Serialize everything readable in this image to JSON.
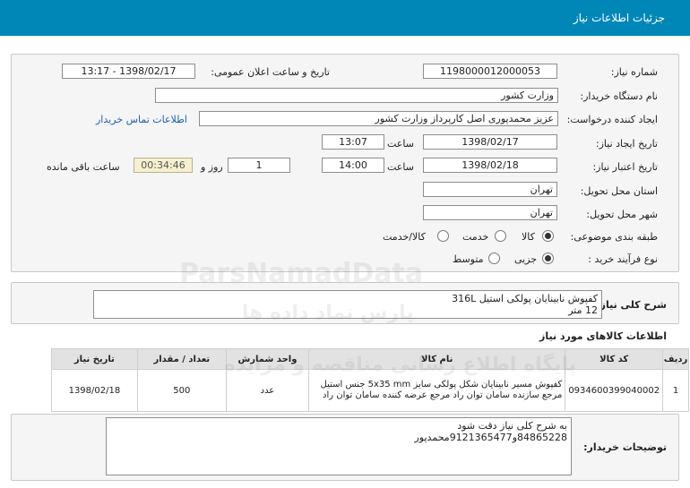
{
  "header": {
    "title": "جزئیات اطلاعات نیاز"
  },
  "form": {
    "need_number_label": "شماره نیاز:",
    "need_number": "1198000012000053",
    "announce_label": "تاریخ و ساعت اعلان عمومی:",
    "announce_value": "1398/02/17 - 13:17",
    "buyer_org_label": "نام دستگاه خریدار:",
    "buyer_org": "وزارت کشور",
    "requester_label": "ایجاد کننده درخواست:",
    "requester": "عزیز محمدپوری اصل کارپرداز وزارت کشور",
    "contact_link": "اطلاعات تماس خریدار",
    "created_date_label": "تاریخ ایجاد نیاز:",
    "created_date": "1398/02/17",
    "time_label": "ساعت",
    "created_time": "13:07",
    "valid_date_label": "تاریخ اعتبار نیاز:",
    "valid_date": "1398/02/18",
    "valid_time": "14:00",
    "days_value": "1",
    "day_and_label": "روز و",
    "remaining_time": "00:34:46",
    "remaining_label": "ساعت باقی مانده",
    "province_label": "استان محل تحویل:",
    "province": "تهران",
    "city_label": "شهر محل تحویل:",
    "city": "تهران",
    "category_label": "طبقه بندی موضوعی:",
    "category_options": [
      "کالا",
      "خدمت",
      "کالا/خدمت"
    ],
    "process_label": "نوع فرآیند خرید :",
    "process_options": [
      "جزیی",
      "متوسط"
    ]
  },
  "summary": {
    "label": "شرح کلی نیاز:",
    "line1": "کفپوش نابینایان پولکی استیل 316L",
    "line2": "12 متر"
  },
  "items": {
    "title": "اطلاعات کالاهای مورد نیاز",
    "headers": [
      "ردیف",
      "کد کالا",
      "نام کالا",
      "واحد شمارش",
      "تعداد / مقدار",
      "تاریخ نیاز"
    ],
    "rows": [
      {
        "row": "1",
        "code": "0934600399040002",
        "name": "کفپوش مسیر نابینایان شکل پولکی سایز 5x35 mm جنس استیل مرجع سازنده سامان توان راد مرجع عرضه کننده سامان توان راد",
        "unit": "عدد",
        "qty": "500",
        "date": "1398/02/18"
      }
    ]
  },
  "buyer_notes": {
    "label": "توضیحات خریدار:",
    "line1": "به شرح کلی نیاز دقت شود",
    "line2": "84865228و9121365477محمدپور"
  },
  "watermark": {
    "brand": "ParsNamadData",
    "line1": "پایگاه اطلاع رسانی مناقصه و مزایده",
    "line2": "پارس نماد داده ها"
  }
}
